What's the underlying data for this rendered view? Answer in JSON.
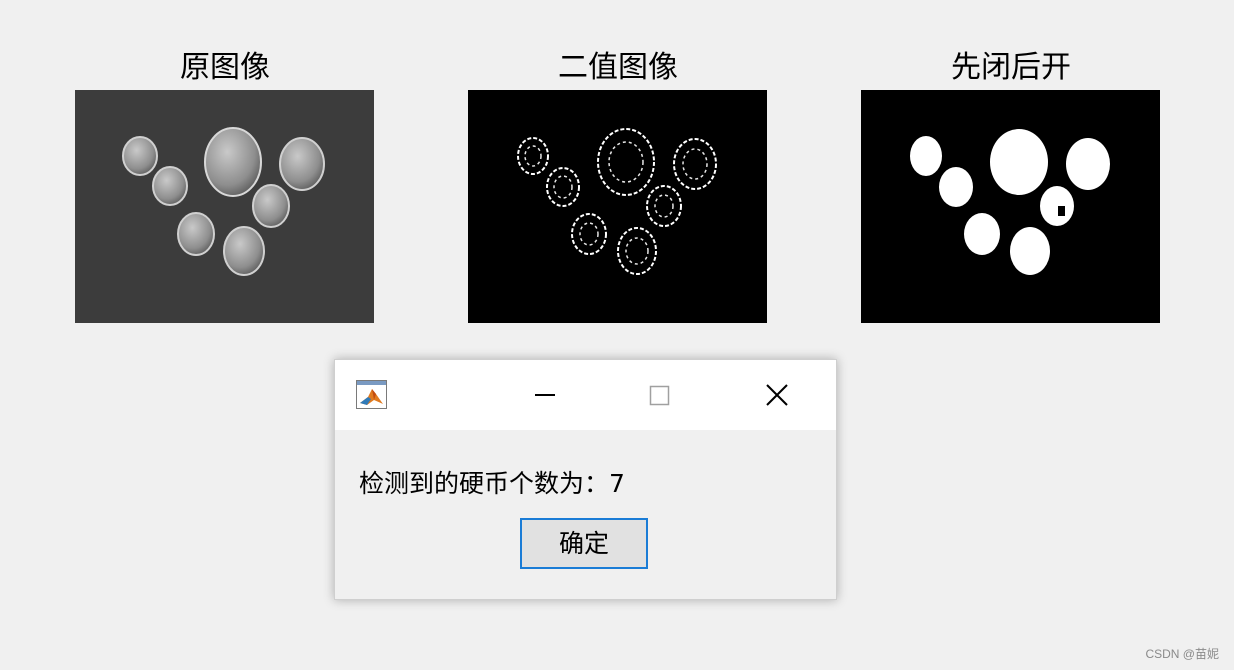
{
  "figure": {
    "panels": [
      {
        "title": "原图像"
      },
      {
        "title": "二值图像"
      },
      {
        "title": "先闭后开"
      }
    ]
  },
  "dialog": {
    "app_icon": "matlab-icon",
    "controls": [
      "minimize-icon",
      "maximize-icon",
      "close-icon"
    ],
    "message": "检测到的硬币个数为：7",
    "ok_label": "确定"
  },
  "watermark": "CSDN @苗妮",
  "colors": {
    "page_bg": "#f0f0f0",
    "original_bg": "#3a3a3a",
    "binary_bg": "#000000",
    "coin_white": "#ffffff",
    "ok_border": "#1a7cd6"
  }
}
